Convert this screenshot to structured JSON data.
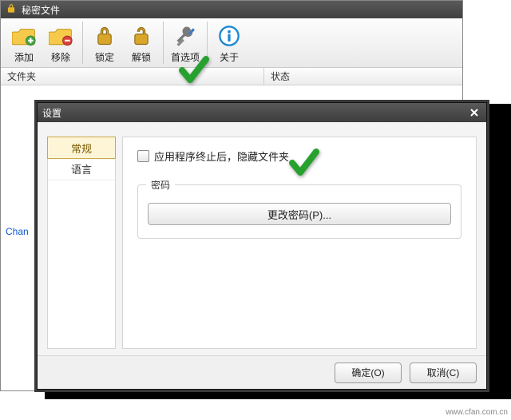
{
  "window": {
    "title": "秘密文件"
  },
  "toolbar": {
    "add": "添加",
    "remove": "移除",
    "lock": "锁定",
    "unlock": "解锁",
    "prefs": "首选项",
    "about": "关于"
  },
  "columns": {
    "folder": "文件夹",
    "status": "状态"
  },
  "list": {
    "row0": "Chan"
  },
  "dialog": {
    "title": "设置",
    "tab_general": "常规",
    "tab_language": "语言",
    "hide_on_exit": "应用程序终止后，隐藏文件夹",
    "password_legend": "密码",
    "change_password": "更改密码(P)...",
    "ok": "确定(O)",
    "cancel": "取消(C)"
  },
  "watermark": "www.cfan.com.cn"
}
